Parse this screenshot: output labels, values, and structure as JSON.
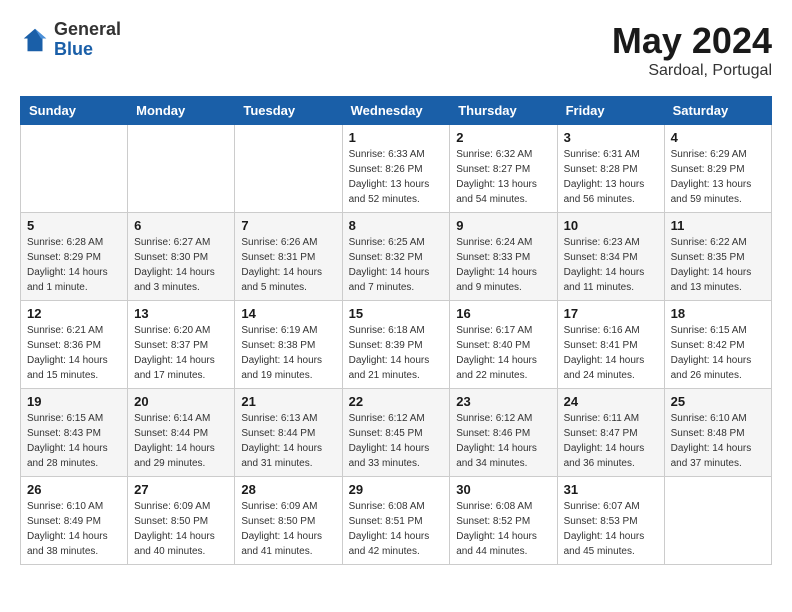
{
  "header": {
    "logo_general": "General",
    "logo_blue": "Blue",
    "month_title": "May 2024",
    "location": "Sardoal, Portugal"
  },
  "weekdays": [
    "Sunday",
    "Monday",
    "Tuesday",
    "Wednesday",
    "Thursday",
    "Friday",
    "Saturday"
  ],
  "weeks": [
    [
      {
        "day": "",
        "info": ""
      },
      {
        "day": "",
        "info": ""
      },
      {
        "day": "",
        "info": ""
      },
      {
        "day": "1",
        "info": "Sunrise: 6:33 AM\nSunset: 8:26 PM\nDaylight: 13 hours\nand 52 minutes."
      },
      {
        "day": "2",
        "info": "Sunrise: 6:32 AM\nSunset: 8:27 PM\nDaylight: 13 hours\nand 54 minutes."
      },
      {
        "day": "3",
        "info": "Sunrise: 6:31 AM\nSunset: 8:28 PM\nDaylight: 13 hours\nand 56 minutes."
      },
      {
        "day": "4",
        "info": "Sunrise: 6:29 AM\nSunset: 8:29 PM\nDaylight: 13 hours\nand 59 minutes."
      }
    ],
    [
      {
        "day": "5",
        "info": "Sunrise: 6:28 AM\nSunset: 8:29 PM\nDaylight: 14 hours\nand 1 minute."
      },
      {
        "day": "6",
        "info": "Sunrise: 6:27 AM\nSunset: 8:30 PM\nDaylight: 14 hours\nand 3 minutes."
      },
      {
        "day": "7",
        "info": "Sunrise: 6:26 AM\nSunset: 8:31 PM\nDaylight: 14 hours\nand 5 minutes."
      },
      {
        "day": "8",
        "info": "Sunrise: 6:25 AM\nSunset: 8:32 PM\nDaylight: 14 hours\nand 7 minutes."
      },
      {
        "day": "9",
        "info": "Sunrise: 6:24 AM\nSunset: 8:33 PM\nDaylight: 14 hours\nand 9 minutes."
      },
      {
        "day": "10",
        "info": "Sunrise: 6:23 AM\nSunset: 8:34 PM\nDaylight: 14 hours\nand 11 minutes."
      },
      {
        "day": "11",
        "info": "Sunrise: 6:22 AM\nSunset: 8:35 PM\nDaylight: 14 hours\nand 13 minutes."
      }
    ],
    [
      {
        "day": "12",
        "info": "Sunrise: 6:21 AM\nSunset: 8:36 PM\nDaylight: 14 hours\nand 15 minutes."
      },
      {
        "day": "13",
        "info": "Sunrise: 6:20 AM\nSunset: 8:37 PM\nDaylight: 14 hours\nand 17 minutes."
      },
      {
        "day": "14",
        "info": "Sunrise: 6:19 AM\nSunset: 8:38 PM\nDaylight: 14 hours\nand 19 minutes."
      },
      {
        "day": "15",
        "info": "Sunrise: 6:18 AM\nSunset: 8:39 PM\nDaylight: 14 hours\nand 21 minutes."
      },
      {
        "day": "16",
        "info": "Sunrise: 6:17 AM\nSunset: 8:40 PM\nDaylight: 14 hours\nand 22 minutes."
      },
      {
        "day": "17",
        "info": "Sunrise: 6:16 AM\nSunset: 8:41 PM\nDaylight: 14 hours\nand 24 minutes."
      },
      {
        "day": "18",
        "info": "Sunrise: 6:15 AM\nSunset: 8:42 PM\nDaylight: 14 hours\nand 26 minutes."
      }
    ],
    [
      {
        "day": "19",
        "info": "Sunrise: 6:15 AM\nSunset: 8:43 PM\nDaylight: 14 hours\nand 28 minutes."
      },
      {
        "day": "20",
        "info": "Sunrise: 6:14 AM\nSunset: 8:44 PM\nDaylight: 14 hours\nand 29 minutes."
      },
      {
        "day": "21",
        "info": "Sunrise: 6:13 AM\nSunset: 8:44 PM\nDaylight: 14 hours\nand 31 minutes."
      },
      {
        "day": "22",
        "info": "Sunrise: 6:12 AM\nSunset: 8:45 PM\nDaylight: 14 hours\nand 33 minutes."
      },
      {
        "day": "23",
        "info": "Sunrise: 6:12 AM\nSunset: 8:46 PM\nDaylight: 14 hours\nand 34 minutes."
      },
      {
        "day": "24",
        "info": "Sunrise: 6:11 AM\nSunset: 8:47 PM\nDaylight: 14 hours\nand 36 minutes."
      },
      {
        "day": "25",
        "info": "Sunrise: 6:10 AM\nSunset: 8:48 PM\nDaylight: 14 hours\nand 37 minutes."
      }
    ],
    [
      {
        "day": "26",
        "info": "Sunrise: 6:10 AM\nSunset: 8:49 PM\nDaylight: 14 hours\nand 38 minutes."
      },
      {
        "day": "27",
        "info": "Sunrise: 6:09 AM\nSunset: 8:50 PM\nDaylight: 14 hours\nand 40 minutes."
      },
      {
        "day": "28",
        "info": "Sunrise: 6:09 AM\nSunset: 8:50 PM\nDaylight: 14 hours\nand 41 minutes."
      },
      {
        "day": "29",
        "info": "Sunrise: 6:08 AM\nSunset: 8:51 PM\nDaylight: 14 hours\nand 42 minutes."
      },
      {
        "day": "30",
        "info": "Sunrise: 6:08 AM\nSunset: 8:52 PM\nDaylight: 14 hours\nand 44 minutes."
      },
      {
        "day": "31",
        "info": "Sunrise: 6:07 AM\nSunset: 8:53 PM\nDaylight: 14 hours\nand 45 minutes."
      },
      {
        "day": "",
        "info": ""
      }
    ]
  ]
}
